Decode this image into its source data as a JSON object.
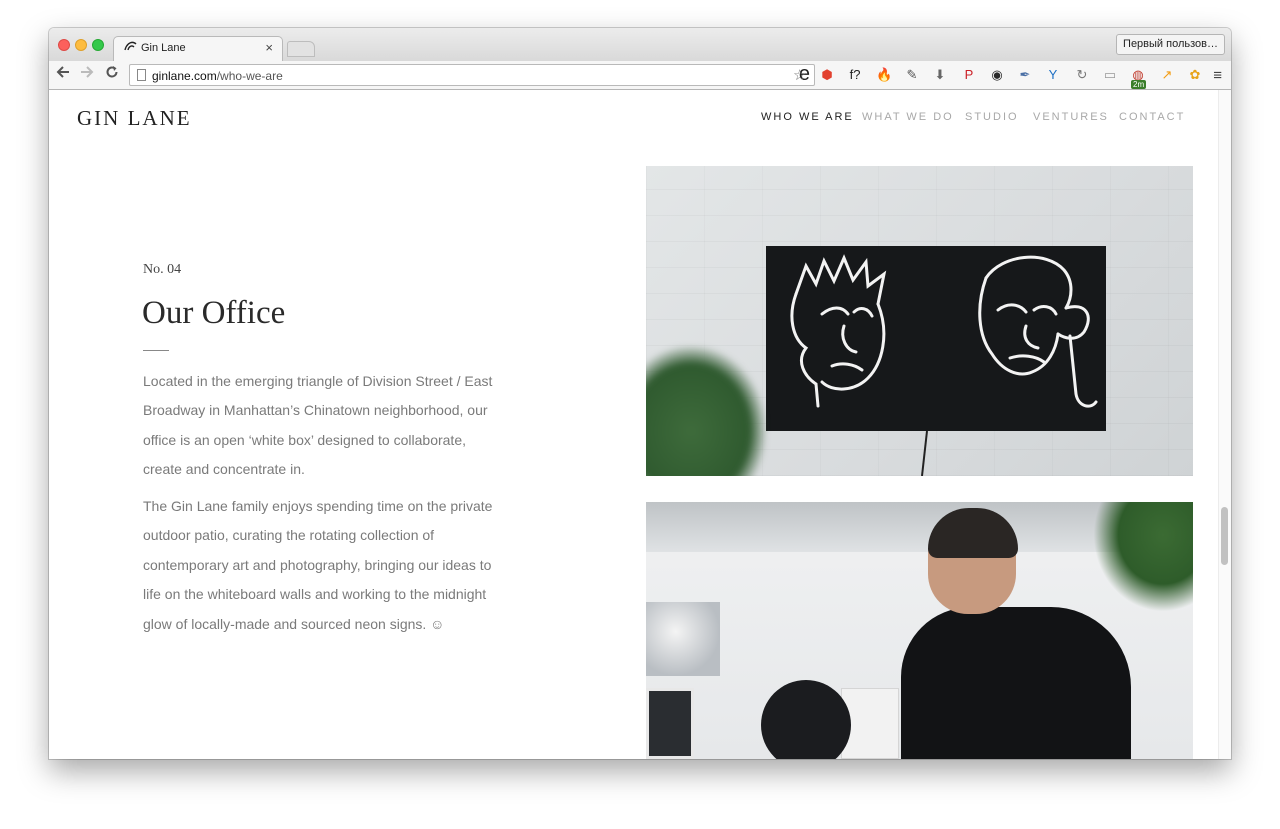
{
  "browser": {
    "tab_title": "Gin Lane",
    "tab_close": "×",
    "profile_button": "Первый пользов…",
    "url_host": "ginlane.com",
    "url_path": "/who-we-are",
    "omnibox_right_glyph": "e",
    "extensions": [
      {
        "name": "adblock-icon",
        "glyph": "⬢",
        "color": "#e2412f"
      },
      {
        "name": "fontface-icon",
        "glyph": "f?",
        "color": "#222222"
      },
      {
        "name": "fire-icon",
        "glyph": "🔥",
        "color": "#f26b1d"
      },
      {
        "name": "evernote-icon",
        "glyph": "✎",
        "color": "#555555"
      },
      {
        "name": "pocket-icon",
        "glyph": "⬇",
        "color": "#666666"
      },
      {
        "name": "pinterest-icon",
        "glyph": "P",
        "color": "#cb2027"
      },
      {
        "name": "camera-icon",
        "glyph": "◉",
        "color": "#2a2a2a"
      },
      {
        "name": "eyedropper-icon",
        "glyph": "✒",
        "color": "#4a6fa5"
      },
      {
        "name": "filter-icon",
        "glyph": "Y",
        "color": "#1d6fc4"
      },
      {
        "name": "reload-ext-icon",
        "glyph": "↻",
        "color": "#777777"
      },
      {
        "name": "reader-icon",
        "glyph": "▭",
        "color": "#999999"
      },
      {
        "name": "stack-icon",
        "glyph": "◍",
        "color": "#c0392b"
      },
      {
        "name": "analytics-icon",
        "glyph": "↗",
        "color": "#f39c12"
      },
      {
        "name": "flower-icon",
        "glyph": "✿",
        "color": "#e8a317"
      }
    ],
    "ext_badge": "2m",
    "menu_glyph": "≡"
  },
  "site": {
    "logo": "GIN LANE",
    "nav": [
      {
        "label": "WHO WE ARE",
        "active": true
      },
      {
        "label": "WHAT WE DO",
        "active": false
      },
      {
        "label": "STUDIO",
        "active": false
      },
      {
        "label": "VENTURES",
        "active": false
      },
      {
        "label": "CONTACT",
        "active": false
      }
    ]
  },
  "section": {
    "kicker": "No. 04",
    "heading": "Our Office",
    "paragraphs": [
      "Located in the emerging triangle of Division Street / East Broadway in Manhattan’s Chinatown neighborhood, our office is an open ‘white box’ designed to collaborate, create and concentrate in.",
      "The Gin Lane family enjoys spending time on the private outdoor patio, curating the rotating collection of contemporary art and photography, bringing our ideas to life on the whiteboard walls and working to the midnight glow of locally-made and sourced neon signs. ☺"
    ]
  }
}
